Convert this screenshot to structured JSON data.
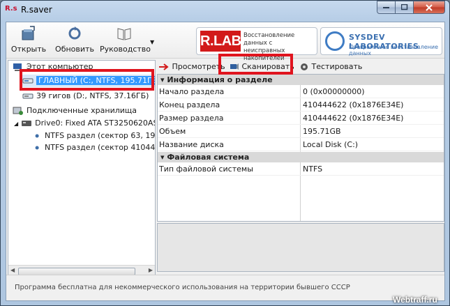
{
  "window": {
    "title": "R.saver",
    "icon_text": "R.s"
  },
  "toolbar": {
    "open": "Открыть",
    "update": "Обновить",
    "guide": "Руководство"
  },
  "ads": {
    "rlab_logo": "R.LAB",
    "rlab_line1": "Восстановление данных с",
    "rlab_line2": "неисправных накопителей",
    "sysdev_name": "SYSDEV LABORATORIES",
    "sysdev_sub": "Программное восстановление данных"
  },
  "tree": {
    "computer": "Этот компьютер",
    "item_main": "ГЛАВНЫЙ (C:, NTFS, 195.71ГБ)",
    "item_d": "39 гигов (D:, NTFS, 37.16ГБ)",
    "connected": "Подключенные хранилища",
    "drive0": "Drive0: Fixed ATA ST3250620AS",
    "part1": "NTFS раздел (сектор 63, 195.",
    "part2": "NTFS раздел (сектор 410444"
  },
  "actions": {
    "view": "Просмотреть",
    "scan": "Сканировать",
    "test": "Тестировать"
  },
  "properties": {
    "section1": "Информация о разделе",
    "rows1": [
      {
        "k": "Начало раздела",
        "v": "0 (0x00000000)"
      },
      {
        "k": "Конец раздела",
        "v": "410444622 (0x1876E34E)"
      },
      {
        "k": "Размер раздела",
        "v": "410444622 (0x1876E34E)"
      },
      {
        "k": "Объем",
        "v": "195.71GB"
      },
      {
        "k": "Название диска",
        "v": "Local Disk (C:)"
      }
    ],
    "section2": "Файловая система",
    "rows2": [
      {
        "k": "Тип файловой системы",
        "v": "NTFS"
      }
    ]
  },
  "status": {
    "text": "Программа бесплатна для некоммерческого использования на территории бывшего СССР"
  },
  "watermark": "Webtraff.ru",
  "colors": {
    "highlight": "#e0141e",
    "selection": "#3399ff",
    "rlab_red": "#d21a1a",
    "sysdev_blue": "#3a6fb0"
  },
  "icons": [
    "open-folder-icon",
    "refresh-icon",
    "book-icon",
    "computer-icon",
    "disk-icon",
    "storage-icon",
    "drive-icon",
    "partition-icon",
    "arrow-right-icon",
    "scan-icon",
    "test-icon"
  ]
}
